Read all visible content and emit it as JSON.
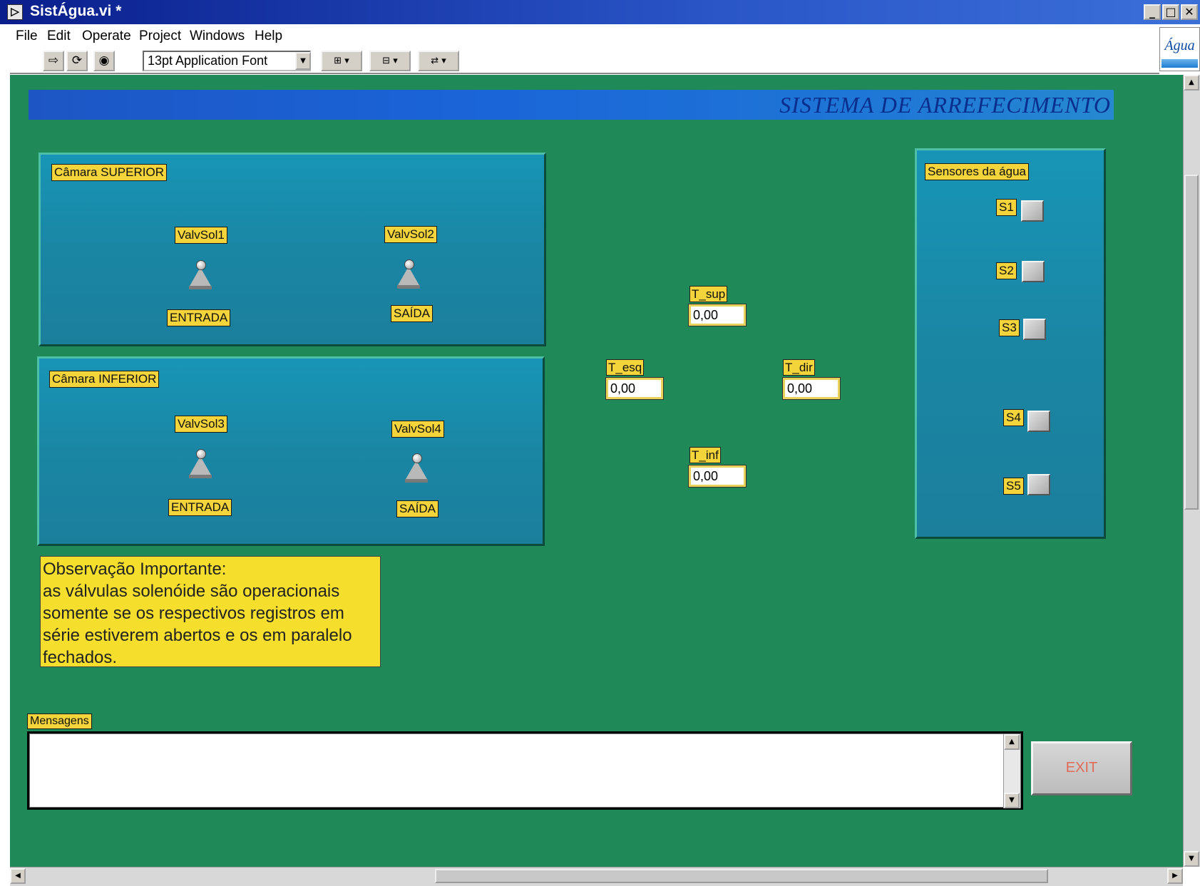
{
  "window": {
    "title": "SistÁgua.vi *",
    "app_icon": "labview-run-icon",
    "controls": [
      "minimize-icon",
      "maximize-icon",
      "close-icon"
    ]
  },
  "menu": [
    "File",
    "Edit",
    "Operate",
    "Project",
    "Windows",
    "Help"
  ],
  "toolbar": {
    "font_select": "13pt Application Font",
    "vi_icon_label": "Água"
  },
  "banner": {
    "title": "SISTEMA DE ARREFECIMENTO"
  },
  "camara_superior": {
    "title": "Câmara SUPERIOR",
    "valve1": {
      "name": "ValvSol1",
      "caption": "ENTRADA"
    },
    "valve2": {
      "name": "ValvSol2",
      "caption": "SAÍDA"
    }
  },
  "camara_inferior": {
    "title": "Câmara INFERIOR",
    "valve3": {
      "name": "ValvSol3",
      "caption": "ENTRADA"
    },
    "valve4": {
      "name": "ValvSol4",
      "caption": "SAÍDA"
    }
  },
  "temps": {
    "t_sup": {
      "label": "T_sup",
      "value": "0,00"
    },
    "t_esq": {
      "label": "T_esq",
      "value": "0,00"
    },
    "t_dir": {
      "label": "T_dir",
      "value": "0,00"
    },
    "t_inf": {
      "label": "T_inf",
      "value": "0,00"
    }
  },
  "sensores": {
    "title": "Sensores da água",
    "items": [
      "S1",
      "S2",
      "S3",
      "S4",
      "S5"
    ]
  },
  "note": {
    "line1": "Observação Importante:",
    "line2": "as válvulas solenóide são operacionais",
    "line3": "somente se os respectivos registros em",
    "line4": "série estiverem abertos e os em paralelo",
    "line5": "fechados."
  },
  "messages": {
    "label": "Mensagens",
    "text": ""
  },
  "exit_button": "EXIT",
  "colors": {
    "panel_bg": "#1f8a58",
    "box_bg": "#1a86a4",
    "label_bg": "#f4d43b",
    "banner_bg": "#1a64d8"
  }
}
